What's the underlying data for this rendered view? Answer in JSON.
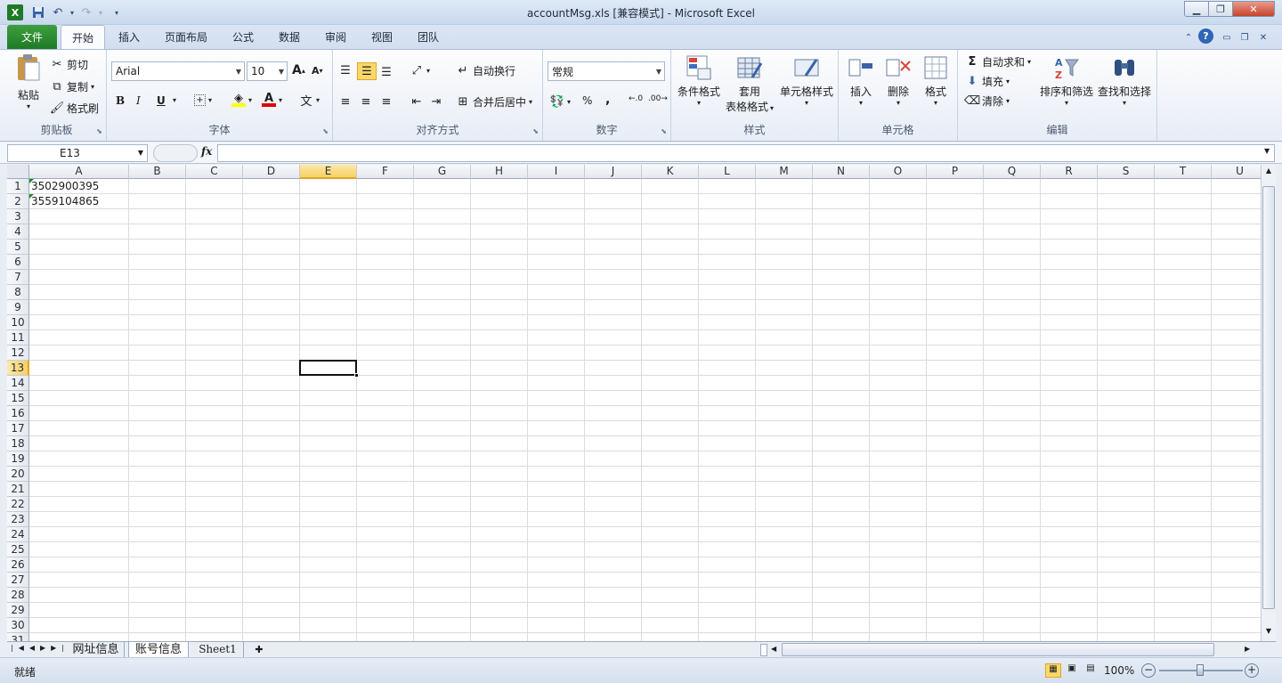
{
  "window": {
    "title": "accountMsg.xls  [兼容模式]  -  Microsoft Excel",
    "minimize_glyph": "▁",
    "restore_glyph": "❐",
    "close_glyph": "✕"
  },
  "qat": {
    "undo_glyph": "↶",
    "redo_glyph": "↷",
    "customize_glyph": "▾"
  },
  "tabs": [
    "文件",
    "开始",
    "插入",
    "页面布局",
    "公式",
    "数据",
    "审阅",
    "视图",
    "团队"
  ],
  "clipboard": {
    "paste": "粘贴",
    "cut": "剪切",
    "copy": "复制",
    "format_painter": "格式刷",
    "group": "剪贴板"
  },
  "font": {
    "name": "Arial",
    "size": "10",
    "group": "字体",
    "bold": "B",
    "italic": "I",
    "underline": "U",
    "grow": "A",
    "shrink": "A"
  },
  "alignment": {
    "wrap": "自动换行",
    "merge": "合并后居中",
    "group": "对齐方式"
  },
  "number": {
    "format": "常规",
    "percent": "%",
    "comma": ",",
    "group": "数字"
  },
  "styles": {
    "conditional": "条件格式",
    "table_1": "套用",
    "table_2": "表格格式",
    "cell_styles": "单元格样式",
    "group": "样式"
  },
  "cells": {
    "insert": "插入",
    "delete": "删除",
    "format": "格式",
    "group": "单元格"
  },
  "editing": {
    "autosum": "自动求和",
    "fill": "填充",
    "clear": "清除",
    "sort": "排序和筛选",
    "find": "查找和选择",
    "group": "编辑"
  },
  "formula_bar": {
    "name_box": "E13",
    "fx": "fx",
    "content": ""
  },
  "grid": {
    "columns": [
      "A",
      "B",
      "C",
      "D",
      "E",
      "F",
      "G",
      "H",
      "I",
      "J",
      "K",
      "L",
      "M",
      "N",
      "O",
      "P",
      "Q",
      "R",
      "S",
      "T",
      "U"
    ],
    "rows": [
      "1",
      "2",
      "3",
      "4",
      "5",
      "6",
      "7",
      "8",
      "9",
      "10",
      "11",
      "12",
      "13",
      "14",
      "15",
      "16",
      "17",
      "18",
      "19",
      "20",
      "21",
      "22",
      "23",
      "24",
      "25",
      "26",
      "27",
      "28",
      "29",
      "30",
      "31"
    ],
    "cells": [
      {
        "ref": "A1",
        "value": "3502900395"
      },
      {
        "ref": "A2",
        "value": "3559104865"
      }
    ],
    "selected_cell": "E13"
  },
  "sheets": [
    "网址信息",
    "账号信息",
    "Sheet1"
  ],
  "active_sheet": "账号信息",
  "status": {
    "ready": "就绪",
    "zoom": "100%"
  }
}
